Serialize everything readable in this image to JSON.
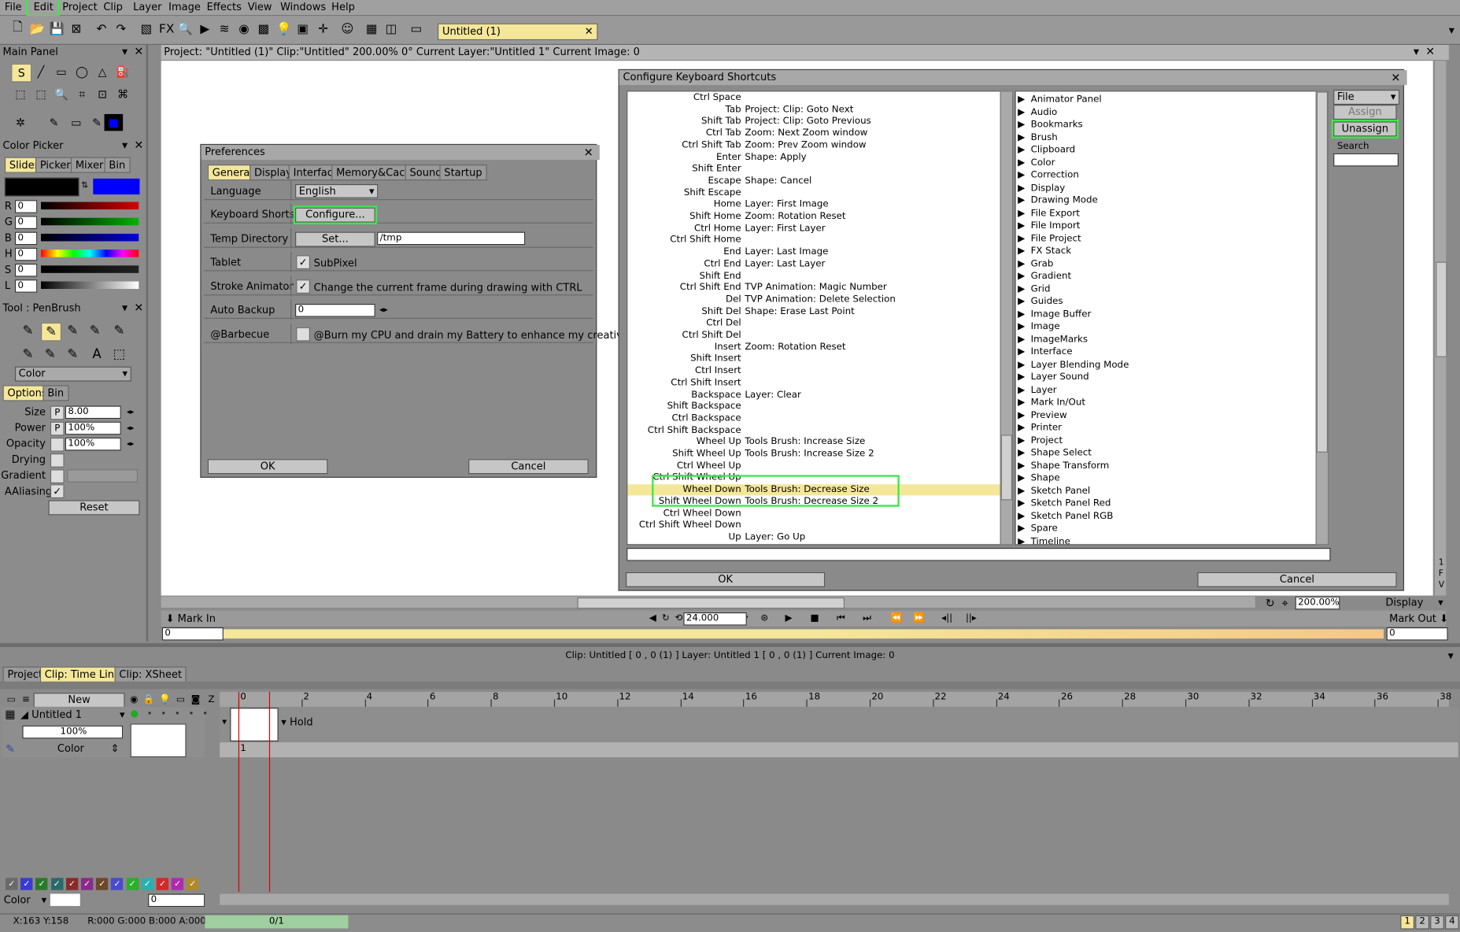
{
  "menu": [
    "File",
    "Edit",
    "Project",
    "Clip",
    "Layer",
    "Image",
    "Effects",
    "View",
    "Windows",
    "Help"
  ],
  "doc_tab": "Untitled (1)",
  "toolbar_icons": [
    "new-icon",
    "open-icon",
    "save-icon",
    "export-icon",
    "undo-icon",
    "redo-icon",
    "draw-mode-icon",
    "fx-icon",
    "zoom-icon",
    "play-icon",
    "layers-icon",
    "color-wheel-icon",
    "gradient-icon",
    "light-icon",
    "image-icon",
    "crosshair-icon",
    "face-icon",
    "grid-icon",
    "split-icon",
    "screen-icon"
  ],
  "status": {
    "text": "Project: \"Untitled (1)\"  Clip:\"Untitled\"   200.00%   0°  Current Layer:\"Untitled 1\"  Current Image: 0"
  },
  "main_panel": {
    "title": "Main Panel"
  },
  "color_picker": {
    "title": "Color Picker",
    "tabs": [
      "Slider",
      "Picker",
      "Mixer",
      "Bin"
    ],
    "channels": [
      {
        "label": "R",
        "value": "0",
        "color": "#d40000"
      },
      {
        "label": "G",
        "value": "0",
        "color": "#00b400"
      },
      {
        "label": "B",
        "value": "0",
        "color": "#0000e0"
      },
      {
        "label": "H",
        "value": "0",
        "color": "rainbow"
      },
      {
        "label": "S",
        "value": "0",
        "color": "#222"
      },
      {
        "label": "L",
        "value": "0",
        "color": "gray"
      }
    ]
  },
  "tool": {
    "title": "Tool : PenBrush",
    "mode": "Color",
    "tabs": [
      "Options",
      "Bin"
    ],
    "rows": [
      {
        "label": "Size",
        "p": "P",
        "value": "8.00"
      },
      {
        "label": "Power",
        "p": "P",
        "value": "100%"
      },
      {
        "label": "Opacity",
        "p": "",
        "value": "100%"
      },
      {
        "label": "Drying",
        "p": "",
        "value": ""
      },
      {
        "label": "Gradient",
        "p": "",
        "value": ""
      }
    ],
    "aaliasing": "AAliasing",
    "reset": "Reset"
  },
  "prefs": {
    "title": "Preferences",
    "tabs": [
      "General",
      "Display",
      "Interface",
      "Memory&Cache",
      "Sound",
      "Startup"
    ],
    "language_label": "Language",
    "language_value": "English",
    "kbd_label": "Keyboard Shorts",
    "configure": "Configure...",
    "temp_label": "Temp Directory",
    "set": "Set...",
    "temp_value": "/tmp",
    "tablet_label": "Tablet",
    "tablet_check": "SubPixel",
    "stroke_label": "Stroke Animator",
    "stroke_check": "Change the current frame during drawing with CTRL",
    "backup_label": "Auto Backup",
    "backup_value": "0",
    "bbq_label": "@Barbecue",
    "bbq_check": "@Burn my CPU and drain my Battery to enhance my creativity",
    "ok": "OK",
    "cancel": "Cancel"
  },
  "kbd": {
    "title": "Configure Keyboard Shortcuts",
    "rows": [
      [
        "Ctrl Space",
        ""
      ],
      [
        "Tab",
        "Project: Clip: Goto Next"
      ],
      [
        "Shift Tab",
        "Project: Clip: Goto Previous"
      ],
      [
        "Ctrl Tab",
        "Zoom: Next Zoom window"
      ],
      [
        "Ctrl Shift Tab",
        "Zoom: Prev Zoom window"
      ],
      [
        "Enter",
        "Shape: Apply"
      ],
      [
        "Shift Enter",
        ""
      ],
      [
        "Escape",
        "Shape: Cancel"
      ],
      [
        "Shift Escape",
        ""
      ],
      [
        "Home",
        "Layer: First Image"
      ],
      [
        "Shift Home",
        "Zoom: Rotation Reset"
      ],
      [
        "Ctrl Home",
        "Layer: First Layer"
      ],
      [
        "Ctrl Shift Home",
        ""
      ],
      [
        "End",
        "Layer: Last Image"
      ],
      [
        "Ctrl End",
        "Layer: Last Layer"
      ],
      [
        "Shift End",
        ""
      ],
      [
        "Ctrl Shift End",
        "TVP Animation: Magic Number"
      ],
      [
        "Del",
        "TVP Animation: Delete Selection"
      ],
      [
        "Shift Del",
        "Shape: Erase Last Point"
      ],
      [
        "Ctrl Del",
        ""
      ],
      [
        "Ctrl Shift Del",
        ""
      ],
      [
        "Insert",
        "Zoom: Rotation Reset"
      ],
      [
        "Shift Insert",
        ""
      ],
      [
        "Ctrl Insert",
        ""
      ],
      [
        "Ctrl Shift Insert",
        ""
      ],
      [
        "Backspace",
        "Layer: Clear"
      ],
      [
        "Shift Backspace",
        ""
      ],
      [
        "Ctrl Backspace",
        ""
      ],
      [
        "Ctrl Shift Backspace",
        ""
      ],
      [
        "Wheel Up",
        "Tools Brush: Increase Size"
      ],
      [
        "Shift Wheel Up",
        "Tools Brush: Increase Size 2"
      ],
      [
        "Ctrl Wheel Up",
        ""
      ],
      [
        "Ctrl Shift Wheel Up",
        ""
      ],
      [
        "Wheel Down",
        "Tools Brush: Decrease Size"
      ],
      [
        "Shift Wheel Down",
        "Tools Brush: Decrease Size 2"
      ],
      [
        "Ctrl Wheel Down",
        ""
      ],
      [
        "Ctrl Shift Wheel Down",
        ""
      ],
      [
        "Up",
        "Layer: Go Up"
      ]
    ],
    "selected_index": 33,
    "categories": [
      "Animator Panel",
      "Audio",
      "Bookmarks",
      "Brush",
      "Clipboard",
      "Color",
      "Correction",
      "Display",
      "Drawing Mode",
      "File Export",
      "File Import",
      "File Project",
      "FX Stack",
      "Grab",
      "Gradient",
      "Grid",
      "Guides",
      "Image Buffer",
      "Image",
      "ImageMarks",
      "Interface",
      "Layer Blending Mode",
      "Layer Sound",
      "Layer",
      "Mark In/Out",
      "Preview",
      "Printer",
      "Project",
      "Shape Select",
      "Shape Transform",
      "Shape",
      "Sketch Panel",
      "Sketch Panel Red",
      "Sketch Panel RGB",
      "Spare",
      "Timeline"
    ],
    "file_select": "File",
    "assign": "Assign",
    "unassign": "Unassign",
    "search": "Search",
    "ok": "OK",
    "cancel": "Cancel"
  },
  "view": {
    "zoom": "200.00%",
    "display": "Display",
    "mark_in": "Mark In",
    "mark_out": "Mark Out",
    "fps": "24.000",
    "in_value": "0",
    "out_value": "0"
  },
  "timeline": {
    "info": "Clip: Untitled [ 0 , 0  (1) ]       Layer: Untitled 1 [ 0 , 0  (1) ]    Current Image: 0",
    "tabs": [
      "Project",
      "Clip: Time Line",
      "Clip: XSheet"
    ],
    "new": "New",
    "layer_name": "Untitled 1",
    "opacity": "100%",
    "mode": "Color",
    "hold": "Hold",
    "frame": "1",
    "ticks": [
      "0",
      "2",
      "4",
      "6",
      "8",
      "10",
      "12",
      "14",
      "16",
      "18",
      "20",
      "22",
      "24",
      "26",
      "28",
      "30",
      "32",
      "34",
      "36",
      "38"
    ],
    "color_mode": "Color",
    "frame_field": "0",
    "swatches": [
      "#6a6a6a",
      "#3b3bd0",
      "#2a7a2a",
      "#2a6a6a",
      "#8a2a2a",
      "#8a2a8a",
      "#6a4a2a",
      "#4a4ad0",
      "#2ab02a",
      "#2ab0b0",
      "#d02a2a",
      "#b02ab0",
      "#b08a2a"
    ]
  },
  "statusbar": {
    "coords": "X:163  Y:158",
    "rgba": "R:000 G:000 B:000 A:000",
    "progress": "0/1",
    "pages": [
      "1",
      "2",
      "3",
      "4"
    ]
  }
}
